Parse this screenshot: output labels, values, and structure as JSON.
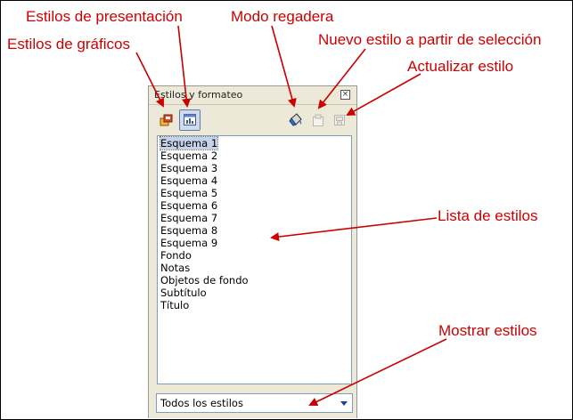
{
  "panel": {
    "title": "Estilos y formateo",
    "close_glyph": "×",
    "toolbar": {
      "graphic_styles_icon": "graphic-styles-icon",
      "presentation_styles_icon": "presentation-styles-icon",
      "fill_format_icon": "paint-bucket-icon",
      "new_style_icon": "new-style-from-selection-icon",
      "update_style_icon": "update-style-icon"
    },
    "styles": [
      "Esquema 1",
      "Esquema 2",
      "Esquema 3",
      "Esquema 4",
      "Esquema 5",
      "Esquema 6",
      "Esquema 7",
      "Esquema 8",
      "Esquema 9",
      "Fondo",
      "Notas",
      "Objetos de fondo",
      "Subtítulo",
      "Título"
    ],
    "selected_index": 0,
    "filter": {
      "value": "Todos los estilos"
    }
  },
  "callouts": {
    "presentation_styles": "Estilos de presentación",
    "graphic_styles": "Estilos de gráficos",
    "fill_mode": "Modo regadera",
    "new_style": "Nuevo estilo a partir de selección",
    "update_style": "Actualizar estilo",
    "styles_list": "Lista de estilos",
    "show_styles": "Mostrar estilos"
  },
  "colors": {
    "callout": "#cc0000",
    "panel_bg": "#ece9d8",
    "selection": "#c4d3ea",
    "list_border": "#7f9db9"
  }
}
